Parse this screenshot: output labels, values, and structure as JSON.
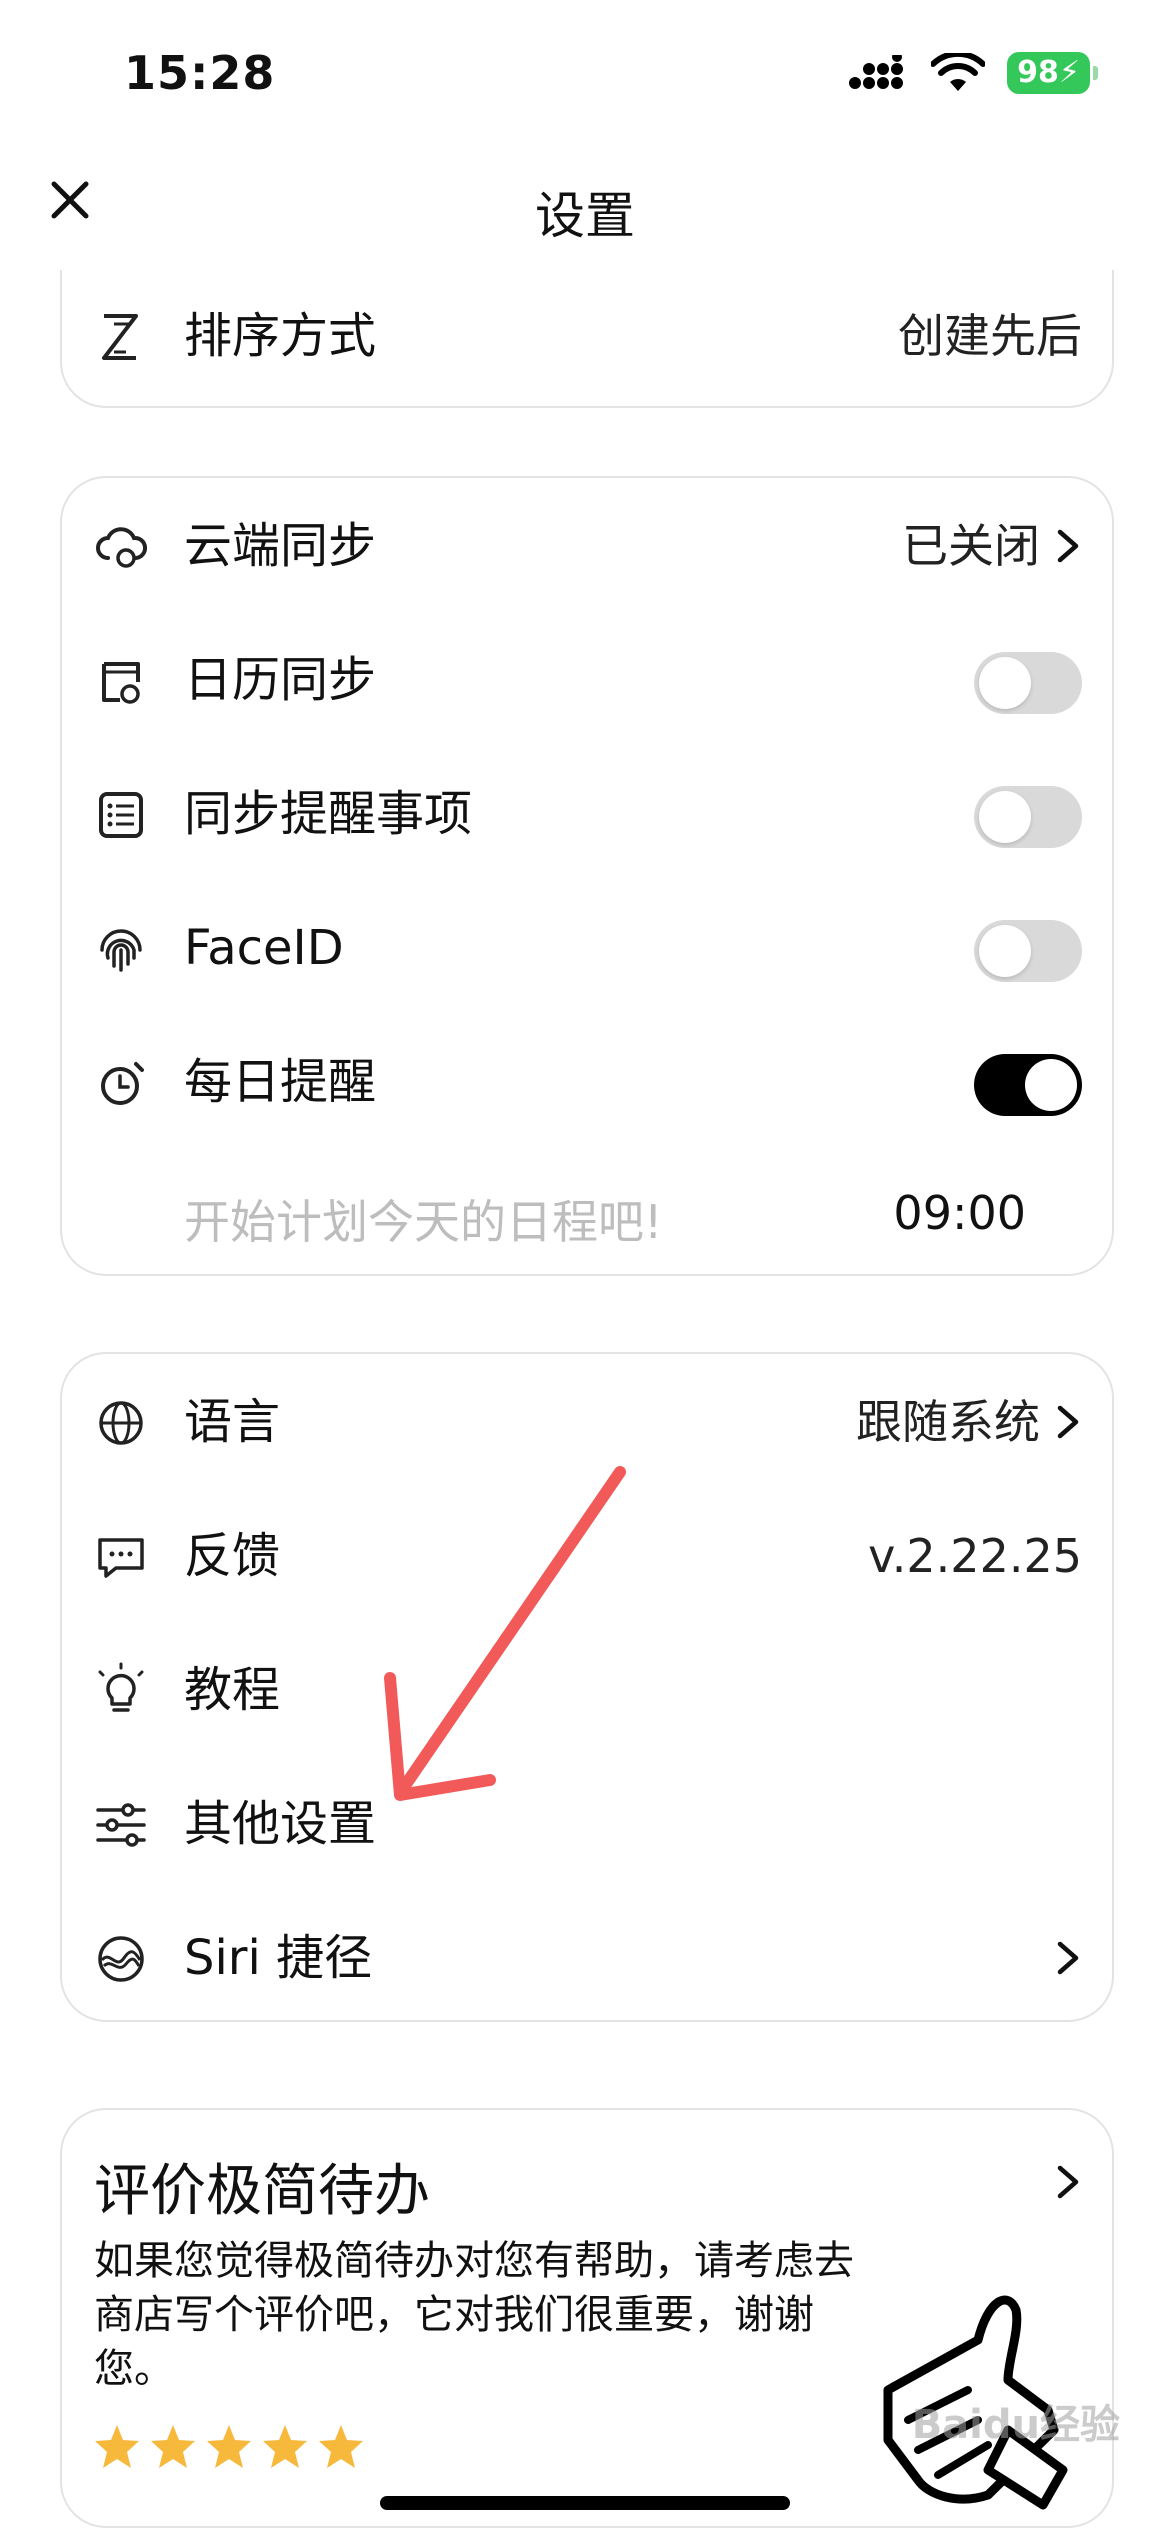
{
  "status_bar": {
    "time": "15:28",
    "battery": "98"
  },
  "nav": {
    "title": "设置"
  },
  "sort_row": {
    "label": "排序方式",
    "value": "创建先后"
  },
  "sync_card": {
    "cloud": {
      "label": "云端同步",
      "value": "已关闭"
    },
    "calendar": {
      "label": "日历同步",
      "toggle": false
    },
    "reminders": {
      "label": "同步提醒事项",
      "toggle": false
    },
    "faceid": {
      "label": "FaceID",
      "toggle": false
    },
    "daily": {
      "label": "每日提醒",
      "toggle": true
    },
    "daily_detail": {
      "placeholder": "开始计划今天的日程吧!",
      "time": "09:00"
    }
  },
  "general_card": {
    "language": {
      "label": "语言",
      "value": "跟随系统"
    },
    "feedback": {
      "label": "反馈",
      "value": "v.2.22.25"
    },
    "tutorial": {
      "label": "教程"
    },
    "other": {
      "label": "其他设置"
    },
    "siri": {
      "label": "Siri 捷径"
    }
  },
  "rate_card": {
    "title": "评价极简待办",
    "description": "如果您觉得极简待办对您有帮助，请考虑去商店写个评价吧，它对我们很重要，谢谢您。",
    "stars": 5
  },
  "watermark": "Baidu经验",
  "colors": {
    "accent_toggle": "#000000",
    "star": "#f6b93b",
    "annotation_arrow": "#f25a5a"
  }
}
